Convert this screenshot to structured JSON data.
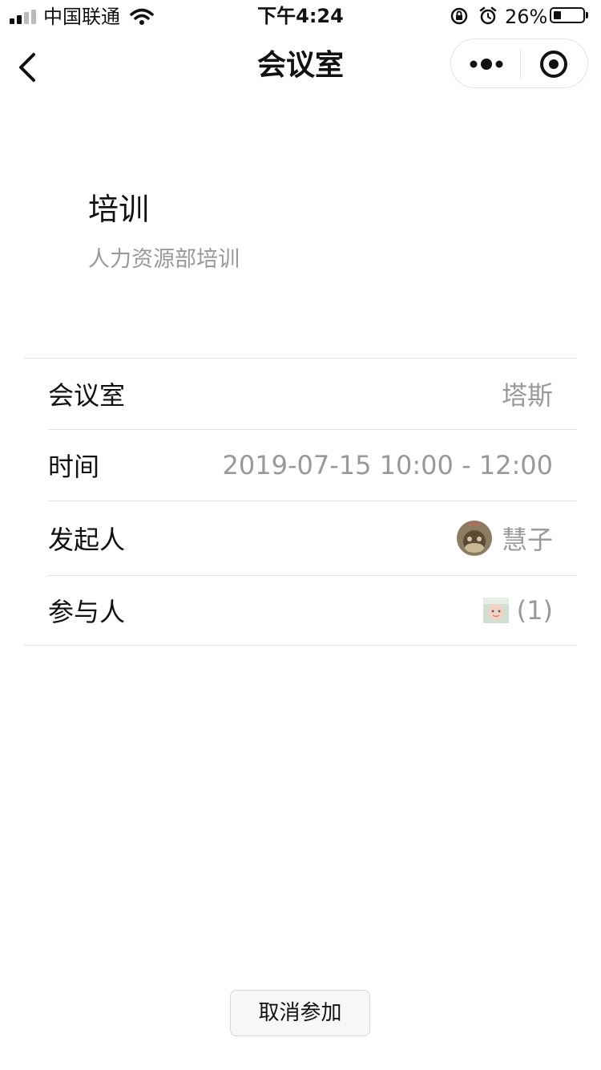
{
  "status_bar": {
    "carrier": "中国联通",
    "time": "下午4:24",
    "battery_percent": "26%",
    "battery_level": 0.26,
    "icons": [
      "signal-icon",
      "wifi-icon",
      "orientation-lock-icon",
      "alarm-icon",
      "battery-icon"
    ]
  },
  "nav": {
    "title": "会议室",
    "icons": [
      "back-icon",
      "more-icon",
      "close-mini-program-icon"
    ]
  },
  "meeting": {
    "title": "培训",
    "description": "人力资源部培训"
  },
  "details": {
    "room": {
      "label": "会议室",
      "value": "塔斯"
    },
    "time": {
      "label": "时间",
      "value": "2019-07-15 10:00 - 12:00"
    },
    "organizer": {
      "label": "发起人",
      "value": "慧子"
    },
    "participants": {
      "label": "参与人",
      "count": "(1)"
    }
  },
  "actions": {
    "cancel_label": "取消参加"
  },
  "colors": {
    "text_primary": "#111111",
    "text_secondary": "#999999",
    "divider": "#e2e2e2",
    "button_bg": "#f7f7f7"
  }
}
